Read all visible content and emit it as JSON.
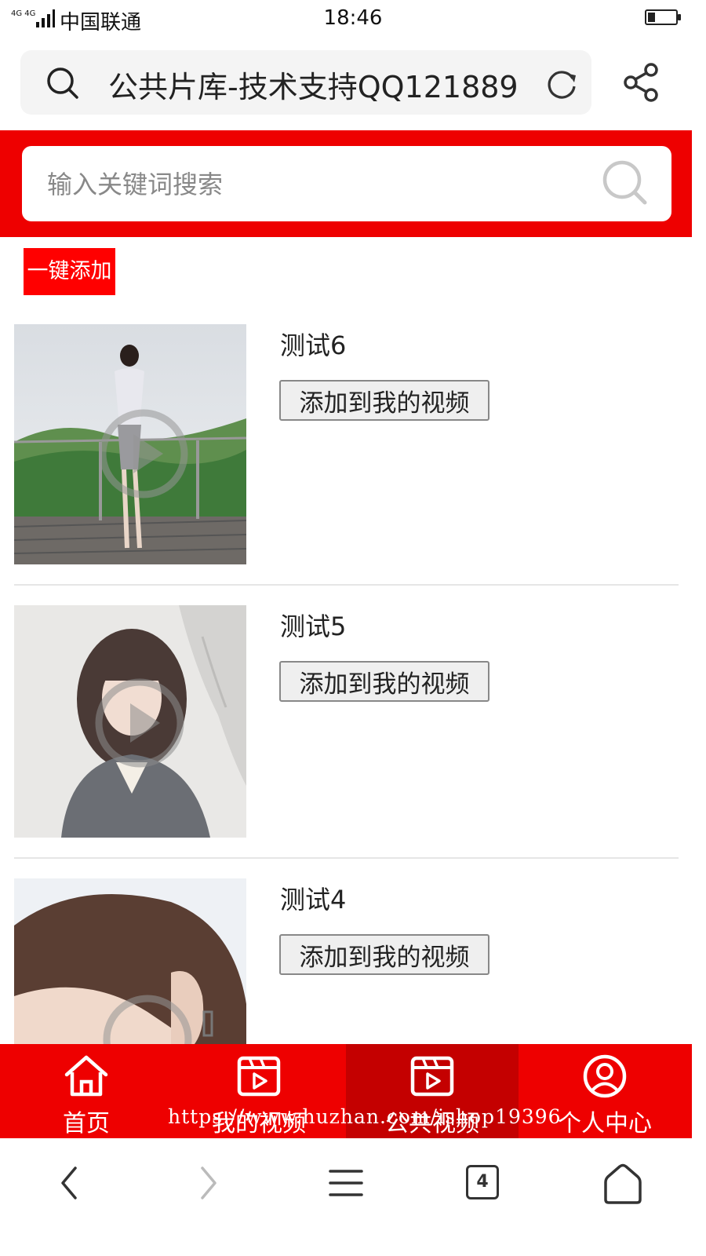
{
  "status_bar": {
    "network": "4G 4G",
    "carrier": "中国联通",
    "time": "18:46",
    "battery_level": 0.25
  },
  "address_bar": {
    "page_title": "公共片库-技术支持QQ121889",
    "search_icon": "search-icon",
    "reload_icon": "reload-icon",
    "share_icon": "share-icon"
  },
  "search": {
    "placeholder": "输入关键词搜索",
    "value": "",
    "icon": "search-icon"
  },
  "one_click_add": "一键添加",
  "videos": [
    {
      "title": "测试6",
      "add_label": "添加到我的视频"
    },
    {
      "title": "测试5",
      "add_label": "添加到我的视频"
    },
    {
      "title": "测试4",
      "add_label": "添加到我的视频"
    }
  ],
  "tab_bar": {
    "items": [
      {
        "label": "首页",
        "icon": "home-icon"
      },
      {
        "label": "我的视频",
        "icon": "video-icon"
      },
      {
        "label": "公共视频",
        "icon": "video-icon"
      },
      {
        "label": "个人中心",
        "icon": "user-icon"
      }
    ],
    "active_index": 2
  },
  "watermark": "https://www.huzhan.com/ishop19396",
  "browser_nav": {
    "back_icon": "back-icon",
    "forward_icon": "forward-icon",
    "menu_icon": "menu-icon",
    "tab_count": "4",
    "home_icon": "home-icon"
  },
  "colors": {
    "brand_red": "#ee0000",
    "button_red": "#ff0000",
    "active_tab": "#c40000"
  }
}
